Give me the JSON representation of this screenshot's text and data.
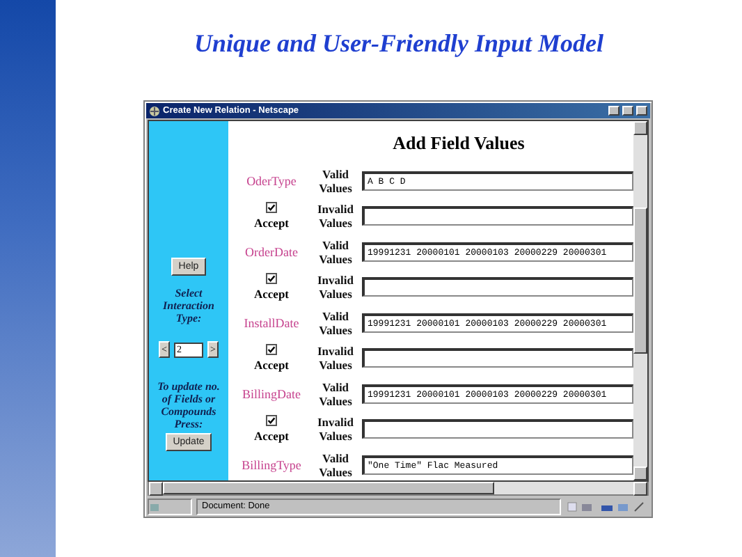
{
  "slide": {
    "title": "Unique and User-Friendly Input Model"
  },
  "window": {
    "title": "Create New Relation - Netscape"
  },
  "sidebar": {
    "help_button": "Help",
    "interaction_label": "Select Interaction Type:",
    "spinner": {
      "prev": "<",
      "value": "2",
      "next": ">"
    },
    "update_label": "To update no. of Fields or Compounds Press:",
    "update_button": "Update"
  },
  "form": {
    "heading": "Add Field Values",
    "fields": [
      {
        "name": "OderType",
        "valid_label": "Valid Values",
        "valid_value": "A B C D",
        "accept": true,
        "accept_label": "Accept",
        "invalid_label": "Invalid Values"
      },
      {
        "name": "OrderDate",
        "valid_label": "Valid Values",
        "valid_value": "19991231 20000101 20000103 20000229 20000301",
        "accept": true,
        "accept_label": "Accept",
        "invalid_label": "Invalid Values"
      },
      {
        "name": "InstallDate",
        "valid_label": "Valid Values",
        "valid_value": "19991231 20000101 20000103 20000229 20000301",
        "accept": true,
        "accept_label": "Accept",
        "invalid_label": "Invalid Values"
      },
      {
        "name": "BillingDate",
        "valid_label": "Valid Values",
        "valid_value": "19991231 20000101 20000103 20000229 20000301",
        "accept": true,
        "accept_label": "Accept",
        "invalid_label": "Invalid Values"
      },
      {
        "name": "BillingType",
        "valid_label": "Valid Values",
        "valid_value": "\"One Time\" Flac Measured"
      }
    ]
  },
  "status_bar": {
    "text": "Document: Done"
  }
}
